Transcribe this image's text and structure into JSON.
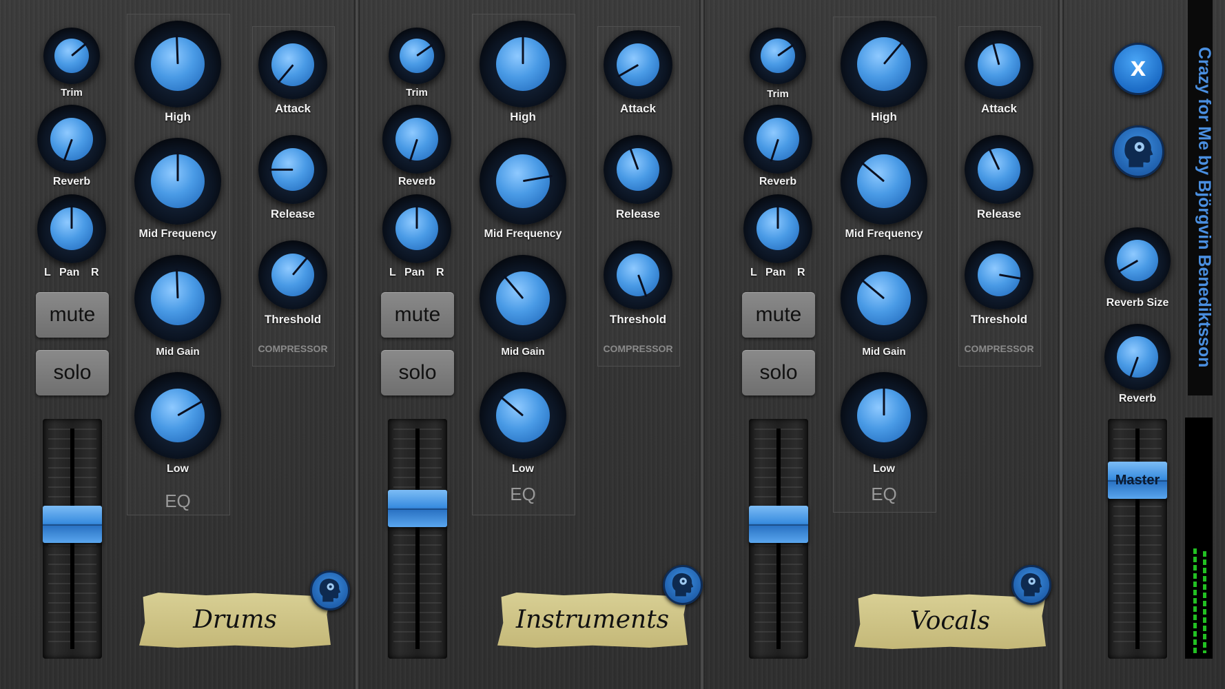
{
  "channels": [
    {
      "name": "Drums",
      "trim": "Trim",
      "reverb": "Reverb",
      "pan": {
        "l": "L",
        "mid": "Pan",
        "r": "R"
      },
      "mute": "mute",
      "solo": "solo",
      "eq": {
        "high": "High",
        "mid_freq": "Mid Frequency",
        "mid_gain": "Mid Gain",
        "low": "Low",
        "title": "EQ"
      },
      "comp": {
        "attack": "Attack",
        "release": "Release",
        "threshold": "Threshold",
        "title": "COMPRESSOR"
      },
      "fader_level": 0.45
    },
    {
      "name": "Instruments",
      "trim": "Trim",
      "reverb": "Reverb",
      "pan": {
        "l": "L",
        "mid": "Pan",
        "r": "R"
      },
      "mute": "mute",
      "solo": "solo",
      "eq": {
        "high": "High",
        "mid_freq": "Mid Frequency",
        "mid_gain": "Mid Gain",
        "low": "Low",
        "title": "EQ"
      },
      "comp": {
        "attack": "Attack",
        "release": "Release",
        "threshold": "Threshold",
        "title": "COMPRESSOR"
      },
      "fader_level": 0.55
    },
    {
      "name": "Vocals",
      "trim": "Trim",
      "reverb": "Reverb",
      "pan": {
        "l": "L",
        "mid": "Pan",
        "r": "R"
      },
      "mute": "mute",
      "solo": "solo",
      "eq": {
        "high": "High",
        "mid_freq": "Mid Frequency",
        "mid_gain": "Mid Gain",
        "low": "Low",
        "title": "EQ"
      },
      "comp": {
        "attack": "Attack",
        "release": "Release",
        "threshold": "Threshold",
        "title": "COMPRESSOR"
      },
      "fader_level": 0.45
    }
  ],
  "master": {
    "reverb_size": "Reverb Size",
    "reverb": "Reverb",
    "fader_label": "Master",
    "fader_level": 0.7,
    "close": "x"
  },
  "song_title": "Crazy for Me by Björgvin Benediktsson",
  "colors": {
    "accent": "#3b8ee0",
    "meter": "#22c022",
    "background": "#333333"
  },
  "icons": [
    "close-icon",
    "head-icon"
  ]
}
